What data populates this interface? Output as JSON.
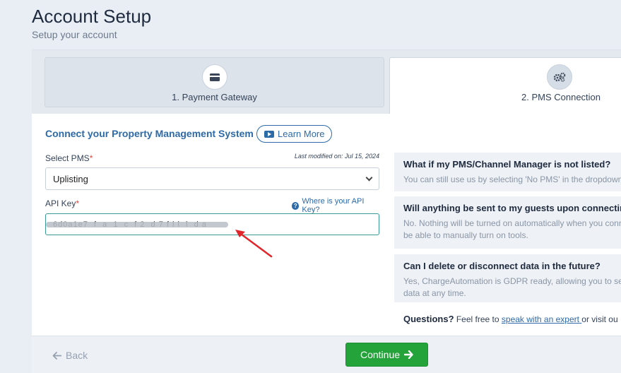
{
  "header": {
    "title": "Account Setup",
    "subtitle": "Setup your account"
  },
  "steps": [
    {
      "label": "1. Payment Gateway",
      "icon": "credit-card-icon"
    },
    {
      "label": "2. PMS Connection",
      "icon": "gears-icon"
    }
  ],
  "form": {
    "section_title": "Connect your Property Management System",
    "learn_more_label": "Learn More",
    "select_label": "Select PMS",
    "required_mark": "*",
    "last_modified": "Last modified on: Jul 15, 2024",
    "selected_pms": "Uplisting",
    "api_key_label": "API Key",
    "api_help_label": "Where is your API Key?",
    "api_key_value": "6d0a1e7  f  a  1  c  f 2  d 7 f l l  l  d a"
  },
  "faq": [
    {
      "question": "What if my PMS/Channel Manager is not listed?",
      "answer": [
        "You can still use us by selecting 'No PMS' in the dropdown"
      ]
    },
    {
      "question": "Will anything be sent to my guests upon connecting?",
      "answer": [
        "No. Nothing will be turned on automatically when you conn",
        "be able to manually turn on tools."
      ]
    },
    {
      "question": "Can I delete or disconnect data in the future?",
      "answer": [
        "Yes, ChargeAutomation is GDPR ready, allowing you to secu",
        "data at any time."
      ]
    }
  ],
  "questions": {
    "lead": "Questions?",
    "text": " Feel free to ",
    "link": "speak with an expert ",
    "tail": "or visit ou"
  },
  "footer": {
    "back_label": "Back",
    "continue_label": "Continue"
  },
  "colors": {
    "accent": "#2d6aa8",
    "success": "#24a33a",
    "annotation_arrow": "#e0262b"
  }
}
